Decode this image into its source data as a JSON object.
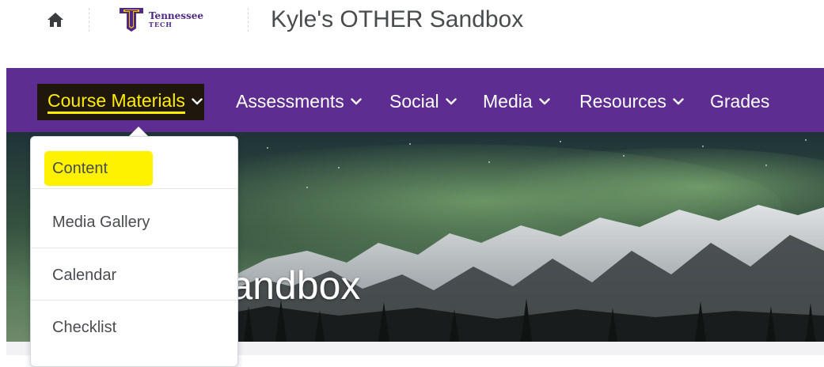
{
  "header": {
    "home_icon": "home-icon",
    "logo_text": "Tennessee",
    "logo_subtext": "TECH",
    "logo_color": "#4f2984",
    "org_title": "Kyle's OTHER Sandbox"
  },
  "nav": {
    "background_color": "#5e2d91",
    "highlight_color": "#ffee00",
    "items": [
      {
        "label": "Course Materials",
        "has_dropdown": true,
        "active": true
      },
      {
        "label": "Assessments",
        "has_dropdown": true
      },
      {
        "label": "Social",
        "has_dropdown": true
      },
      {
        "label": "Media",
        "has_dropdown": true
      },
      {
        "label": "Resources",
        "has_dropdown": true
      },
      {
        "label": "Grades",
        "has_dropdown": false
      }
    ]
  },
  "banner": {
    "title_visible": "THER Sandbox",
    "image_description_icon": "mountain-aurora-image"
  },
  "dropdown": {
    "items": [
      {
        "label": "Content",
        "highlighted": true
      },
      {
        "label": "Media Gallery"
      },
      {
        "label": "Calendar"
      },
      {
        "label": "Checklist"
      }
    ],
    "highlight_color": "#fff200"
  }
}
